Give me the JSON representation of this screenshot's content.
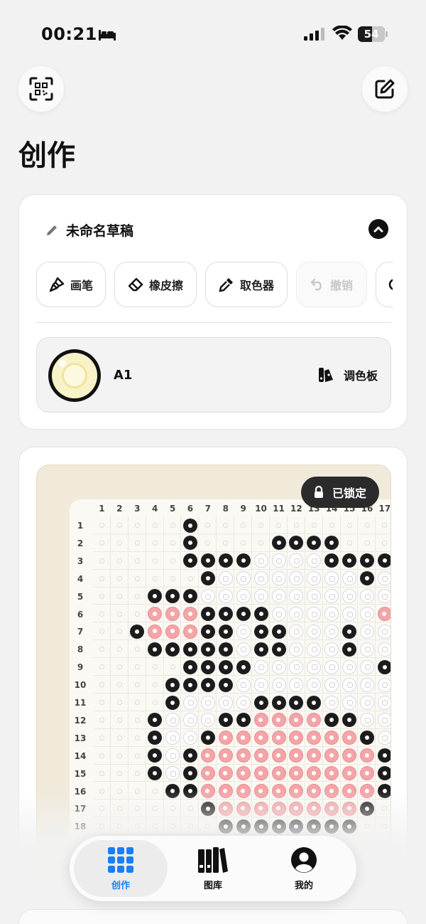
{
  "status_bar": {
    "time": "00:21",
    "battery": "54"
  },
  "page": {
    "title": "创作"
  },
  "draft": {
    "name": "未命名草稿"
  },
  "tools": [
    {
      "label": "画笔",
      "icon": "brush-icon",
      "enabled": true
    },
    {
      "label": "橡皮擦",
      "icon": "eraser-icon",
      "enabled": true
    },
    {
      "label": "取色器",
      "icon": "eyedropper-icon",
      "enabled": true
    },
    {
      "label": "撤销",
      "icon": "undo-icon",
      "enabled": false
    }
  ],
  "current_color": {
    "code": "A1",
    "palette_label": "调色板"
  },
  "canvas": {
    "lock_label": "已锁定",
    "col_numbers": [
      "1",
      "2",
      "3",
      "4",
      "5",
      "6",
      "7",
      "8",
      "9",
      "10",
      "11",
      "12",
      "13",
      "14",
      "15",
      "16",
      "17"
    ],
    "row_numbers": [
      "1",
      "2",
      "3",
      "4",
      "5",
      "6",
      "7",
      "8",
      "9",
      "10",
      "11",
      "12",
      "13",
      "14",
      "15",
      "16",
      "17",
      "18"
    ],
    "rows": [
      ".... K............",
      ".....K....KKKK...K",
      ".....KKKKWWWWKKKK",
      "......KWWWWWWWWKW",
      "...KKKWWWWWWWWWWW",
      "...PPPKKKKWWWWWWP",
      "..KPPPKKWKKWWWKWW",
      "...KKKKKWKKWWWKWW",
      ".....KKKKWWWWWWWK",
      "....KKKKWWWWWWWWW",
      "....KWWWWKKKKWWWW",
      "...KWWWKKPPPPKKWW",
      "...KWWKPPPPPPPPKW",
      "...KWKPPPPPPPPPPK",
      "...KWKPPPPPPPPPPK",
      "....KKPPPPPPPPPPK",
      "......KPPPPPPPPK.",
      ".......KKKKKKKK.."
    ]
  },
  "tabbar": [
    {
      "label": "创作",
      "icon": "grid-icon",
      "active": true
    },
    {
      "label": "图库",
      "icon": "library-icon",
      "active": false
    },
    {
      "label": "我的",
      "icon": "profile-icon",
      "active": false
    }
  ]
}
